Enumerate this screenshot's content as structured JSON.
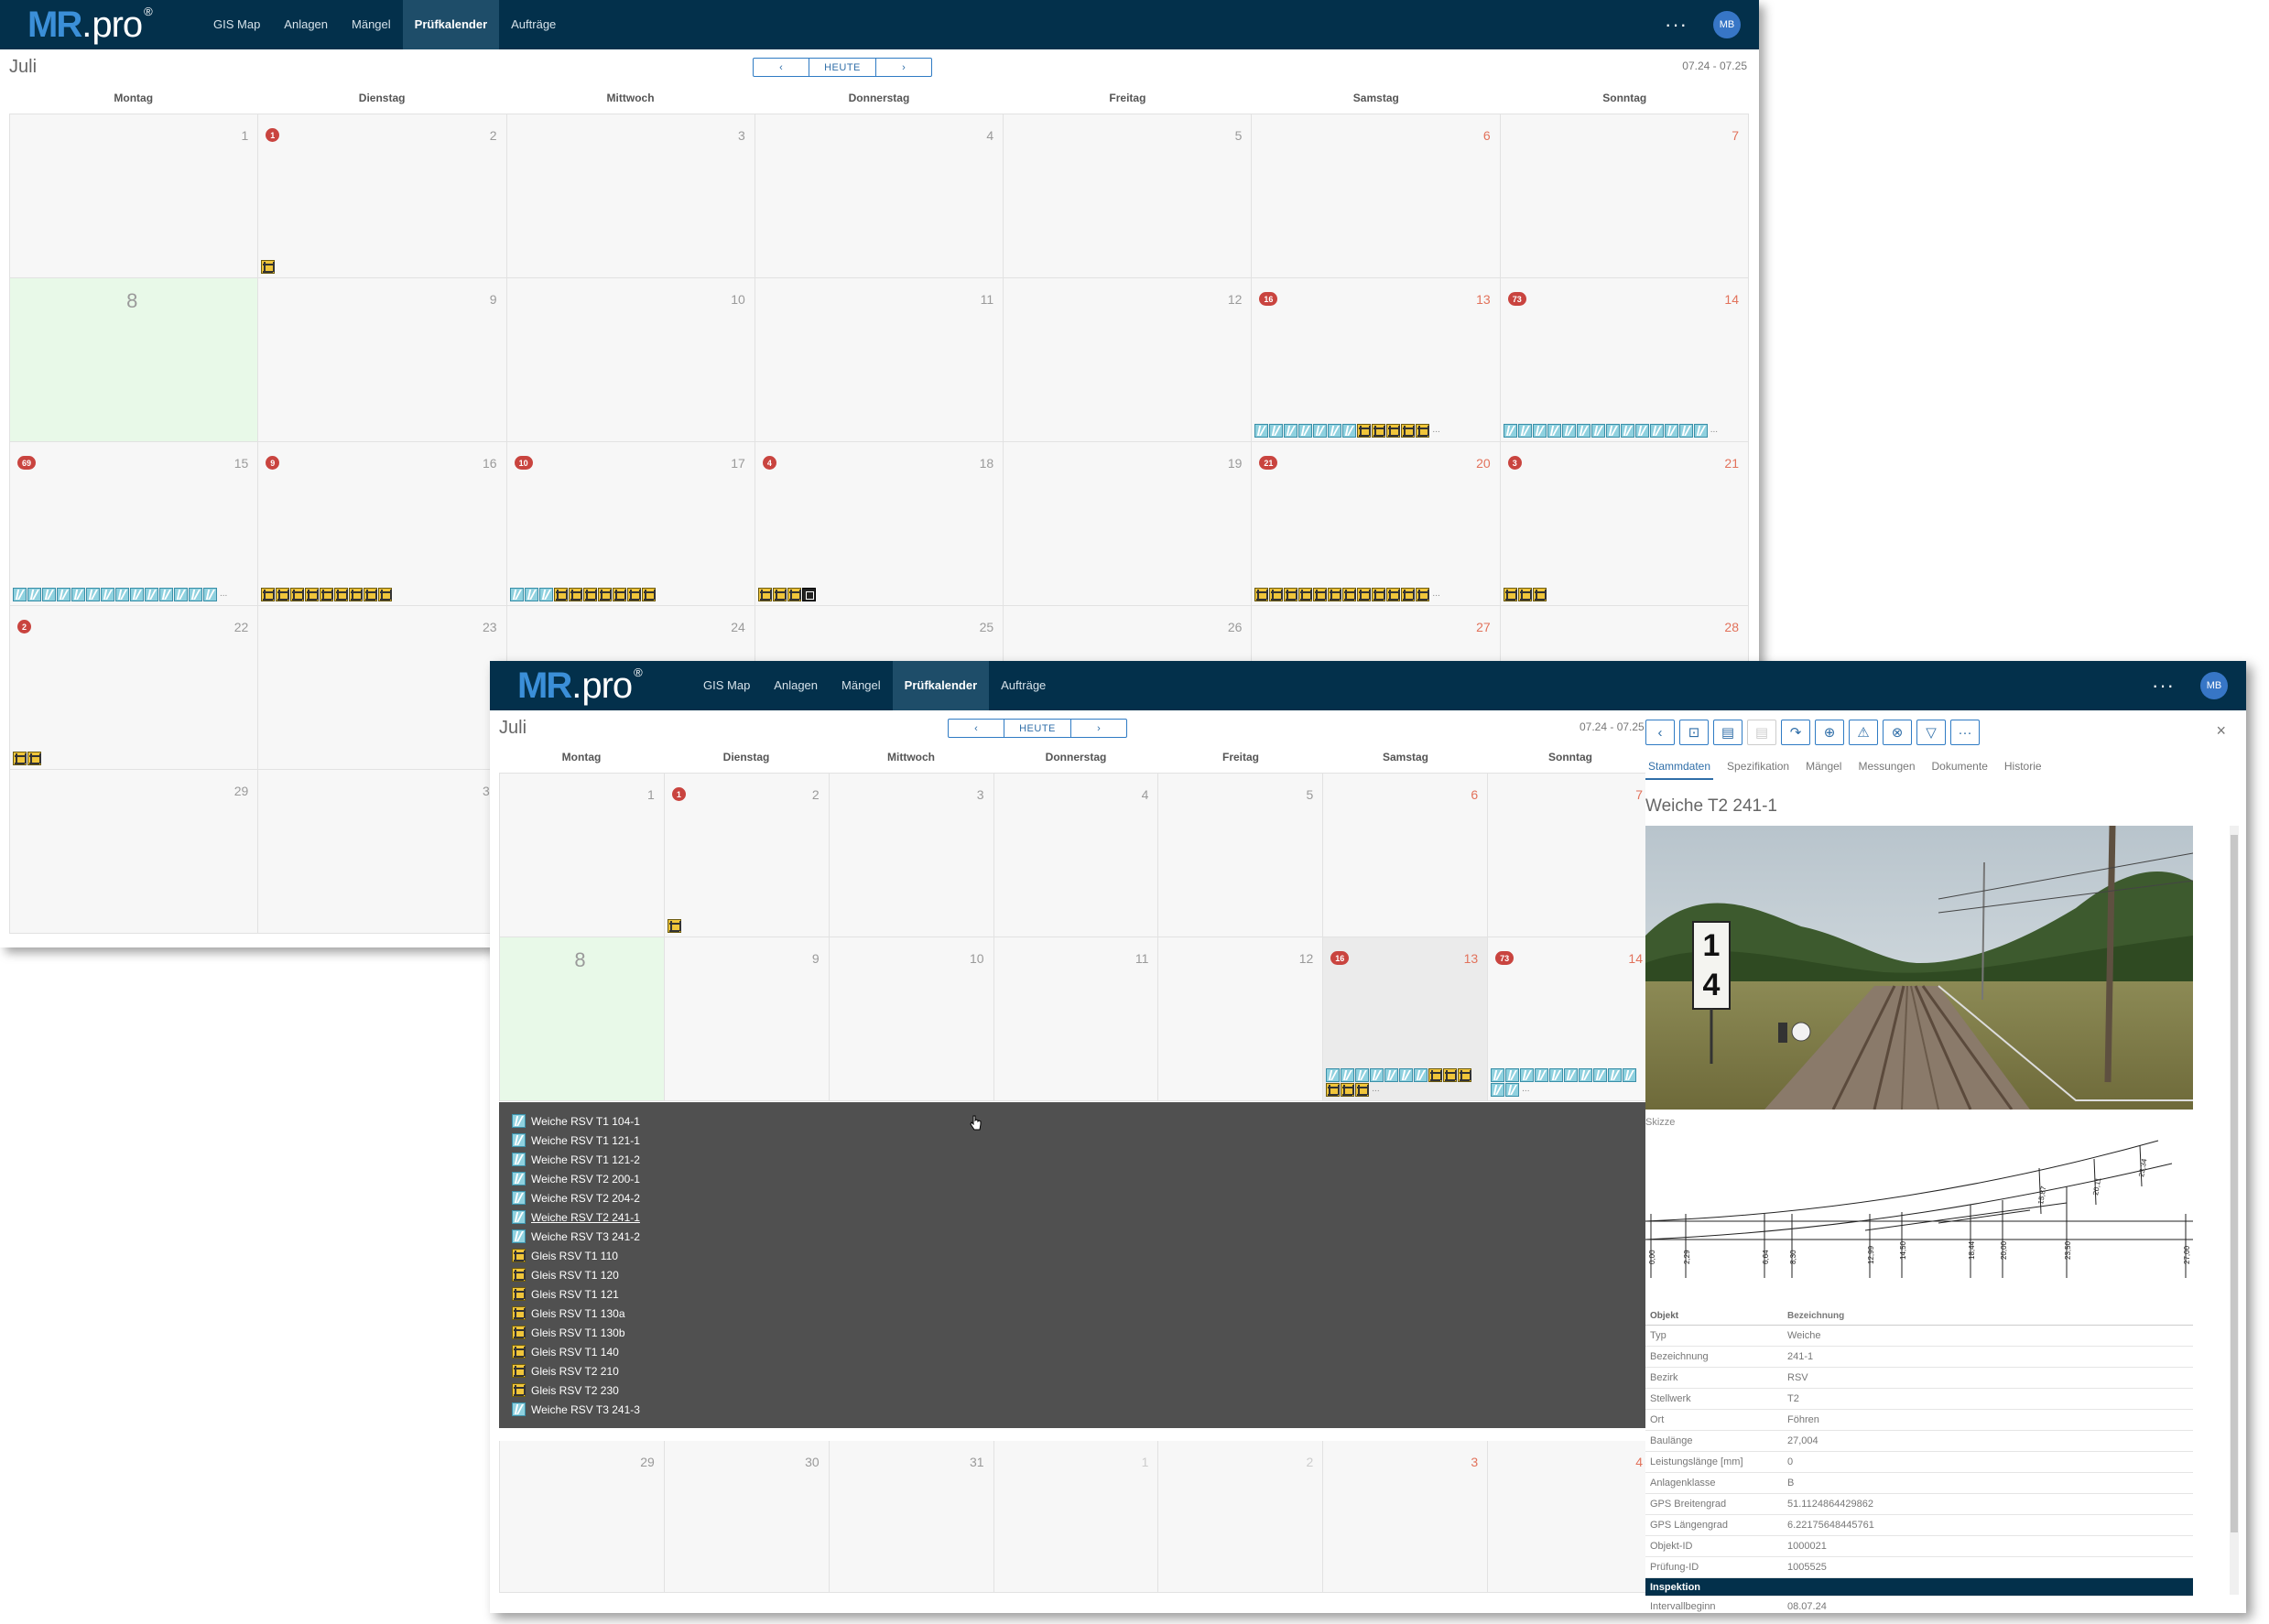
{
  "app": {
    "logo_main": "MR",
    "logo_dot": ".",
    "logo_rest": "pro",
    "logo_sup": "®",
    "nav": [
      "GIS Map",
      "Anlagen",
      "Mängel",
      "Prüfkalender",
      "Aufträge"
    ],
    "active_nav": "Prüfkalender",
    "more_icon": "···",
    "user_initials": "MB"
  },
  "calendar": {
    "month": "Juli",
    "prev_icon": "‹",
    "today_label": "HEUTE",
    "next_icon": "›",
    "range": "07.24 - 07.25",
    "weekdays": [
      "Montag",
      "Dienstag",
      "Mittwoch",
      "Donnerstag",
      "Freitag",
      "Samstag",
      "Sonntag"
    ]
  },
  "window1": {
    "weeks": [
      [
        {
          "day": "1"
        },
        {
          "day": "2",
          "badge": "1",
          "icons": "g"
        },
        {
          "day": "3"
        },
        {
          "day": "4"
        },
        {
          "day": "5"
        },
        {
          "day": "6",
          "wknd": true
        },
        {
          "day": "7",
          "wknd": true
        }
      ],
      [
        {
          "day": "8",
          "today": true
        },
        {
          "day": "9"
        },
        {
          "day": "10"
        },
        {
          "day": "11"
        },
        {
          "day": "12"
        },
        {
          "day": "13",
          "wknd": true,
          "badge": "16",
          "icons": "wwwwwwwggggg",
          "more": "..."
        },
        {
          "day": "14",
          "wknd": true,
          "badge": "73",
          "icons": "wwwwwwwwwwwwww",
          "more": "..."
        }
      ],
      [
        {
          "day": "15",
          "badge": "69",
          "icons": "wwwwwwwwwwwwww",
          "more": "..."
        },
        {
          "day": "16",
          "badge": "9",
          "icons": "ggggggggg"
        },
        {
          "day": "17",
          "badge": "10",
          "icons": "wwwggggggg"
        },
        {
          "day": "18",
          "badge": "4",
          "icons": "gggb"
        },
        {
          "day": "19"
        },
        {
          "day": "20",
          "wknd": true,
          "badge": "21",
          "icons": "gggggggggggg",
          "more": "..."
        },
        {
          "day": "21",
          "wknd": true,
          "badge": "3",
          "icons": "ggg"
        }
      ],
      [
        {
          "day": "22",
          "badge": "2",
          "icons": "gg"
        },
        {
          "day": "23"
        },
        {
          "day": "24"
        },
        {
          "day": "25"
        },
        {
          "day": "26"
        },
        {
          "day": "27",
          "wknd": true
        },
        {
          "day": "28",
          "wknd": true
        }
      ],
      [
        {
          "day": "29"
        },
        {
          "day": "30"
        },
        {
          "day": "31"
        },
        {
          "day": "1",
          "out": true
        },
        {
          "day": "2",
          "out": true
        },
        {
          "day": "3",
          "out": true,
          "wknd": true
        },
        {
          "day": "4",
          "out": true,
          "wknd": true
        }
      ]
    ]
  },
  "window2": {
    "weeks": [
      [
        {
          "day": "1"
        },
        {
          "day": "2",
          "badge": "1",
          "icons": "g"
        },
        {
          "day": "3"
        },
        {
          "day": "4"
        },
        {
          "day": "5"
        },
        {
          "day": "6",
          "wknd": true
        },
        {
          "day": "7",
          "wknd": true
        }
      ],
      [
        {
          "day": "8",
          "today": true
        },
        {
          "day": "9"
        },
        {
          "day": "10"
        },
        {
          "day": "11"
        },
        {
          "day": "12"
        },
        {
          "day": "13",
          "wknd": true,
          "sel": true,
          "badge": "16",
          "icons": "wwwwwwwgggggg",
          "more": "..."
        },
        {
          "day": "14",
          "wknd": true,
          "badge": "73",
          "icons": "wwwwwwwwwwww",
          "more": "..."
        }
      ]
    ],
    "last_week": [
      {
        "day": "29"
      },
      {
        "day": "30"
      },
      {
        "day": "31"
      },
      {
        "day": "1",
        "out": true
      },
      {
        "day": "2",
        "out": true
      },
      {
        "day": "3",
        "out": true,
        "wknd": true
      },
      {
        "day": "4",
        "out": true,
        "wknd": true
      }
    ],
    "popup_items": [
      {
        "type": "w",
        "label": "Weiche RSV T1 104-1"
      },
      {
        "type": "w",
        "label": "Weiche RSV T1 121-1"
      },
      {
        "type": "w",
        "label": "Weiche RSV T1 121-2"
      },
      {
        "type": "w",
        "label": "Weiche RSV T2 200-1"
      },
      {
        "type": "w",
        "label": "Weiche RSV T2 204-2"
      },
      {
        "type": "w",
        "label": "Weiche RSV T2 241-1",
        "hover": true
      },
      {
        "type": "w",
        "label": "Weiche RSV T3 241-2"
      },
      {
        "type": "g",
        "label": "Gleis RSV T1 110"
      },
      {
        "type": "g",
        "label": "Gleis RSV T1 120"
      },
      {
        "type": "g",
        "label": "Gleis RSV T1 121"
      },
      {
        "type": "g",
        "label": "Gleis RSV T1 130a"
      },
      {
        "type": "g",
        "label": "Gleis RSV T1 130b"
      },
      {
        "type": "g",
        "label": "Gleis RSV T1 140"
      },
      {
        "type": "g",
        "label": "Gleis RSV T2 210"
      },
      {
        "type": "g",
        "label": "Gleis RSV T2 230"
      },
      {
        "type": "w",
        "label": "Weiche RSV T3 241-3"
      }
    ]
  },
  "panel": {
    "tool_icons": [
      "back-icon",
      "map-icon",
      "document-icon",
      "doc-disabled-icon",
      "redo-icon",
      "add-circle-icon",
      "warning-icon",
      "cancel-circle-icon",
      "filter-icon",
      "more-icon"
    ],
    "tool_glyphs": [
      "‹",
      "⊡",
      "▤",
      "▤",
      "↷",
      "⊕",
      "⚠",
      "⊗",
      "▽",
      "···"
    ],
    "close_icon": "×",
    "tabs": [
      "Stammdaten",
      "Spezifikation",
      "Mängel",
      "Messungen",
      "Dokumente",
      "Historie"
    ],
    "active_tab": "Stammdaten",
    "title": "Weiche T2 241-1",
    "sketch_label": "Skizze",
    "table_header": {
      "k": "Objekt",
      "v": "Bezeichnung"
    },
    "rows": [
      {
        "k": "Typ",
        "v": "Weiche"
      },
      {
        "k": "Bezeichnung",
        "v": "241-1"
      },
      {
        "k": "Bezirk",
        "v": "RSV"
      },
      {
        "k": "Stellwerk",
        "v": "T2"
      },
      {
        "k": "Ort",
        "v": "Föhren"
      },
      {
        "k": "Baulänge",
        "v": "27,004"
      },
      {
        "k": "Leistungslänge [mm]",
        "v": "0"
      },
      {
        "k": "Anlagenklasse",
        "v": "B"
      },
      {
        "k": "GPS Breitengrad",
        "v": "51.1124864429862"
      },
      {
        "k": "GPS Längengrad",
        "v": "6.22175648445761"
      },
      {
        "k": "Objekt-ID",
        "v": "1000021"
      },
      {
        "k": "Prüfung-ID",
        "v": "1005525"
      }
    ],
    "section": "Inspektion",
    "rows2": [
      {
        "k": "Intervallbeginn",
        "v": "08.07.24"
      }
    ],
    "photo_sign": "1 4"
  },
  "colors": {
    "topbar": "#03304b",
    "accent": "#2f7bc4",
    "badge": "#c9443f",
    "weiche_icon": "#8fd1df",
    "gleis_icon": "#f0c53a"
  }
}
